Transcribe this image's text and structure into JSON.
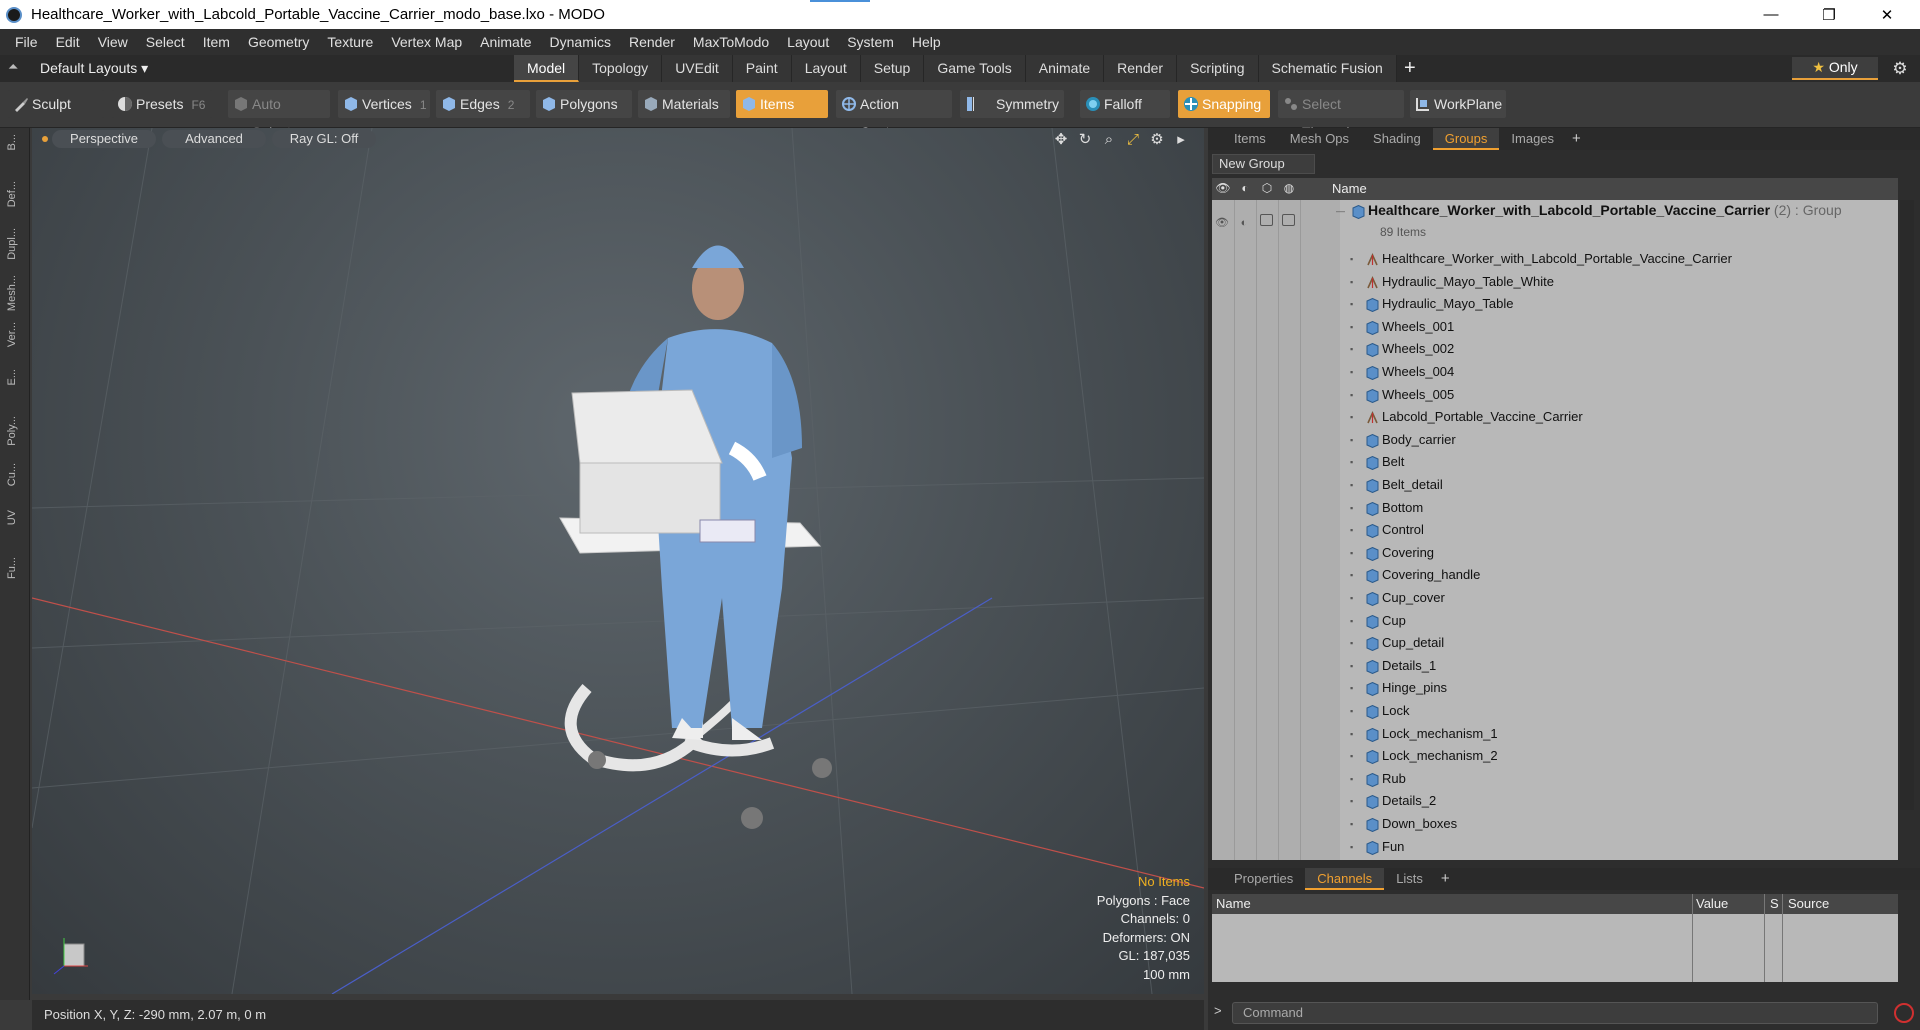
{
  "window": {
    "title": "Healthcare_Worker_with_Labcold_Portable_Vaccine_Carrier_modo_base.lxo - MODO",
    "minimize": "—",
    "maximize": "❐",
    "close": "✕"
  },
  "menu": [
    "File",
    "Edit",
    "View",
    "Select",
    "Item",
    "Geometry",
    "Texture",
    "Vertex Map",
    "Animate",
    "Dynamics",
    "Render",
    "MaxToModo",
    "Layout",
    "System",
    "Help"
  ],
  "layouts": {
    "label": "Default Layouts ▾"
  },
  "tabs": [
    "Model",
    "Topology",
    "UVEdit",
    "Paint",
    "Layout",
    "Setup",
    "Game Tools",
    "Animate",
    "Render",
    "Scripting",
    "Schematic Fusion"
  ],
  "tabs_active": "Model",
  "tab_add": "+",
  "only": {
    "star": "★",
    "label": "Only"
  },
  "toolbar": {
    "sculpt": "Sculpt",
    "presets": "Presets",
    "presets_key": "F6",
    "auto_select": "Auto Select",
    "vertices": "Vertices",
    "vertices_count": "1",
    "edges": "Edges",
    "edges_count": "2",
    "polygons": "Polygons",
    "materials": "Materials",
    "items": "Items",
    "action_center": "Action Center",
    "symmetry": "Symmetry",
    "falloff": "Falloff",
    "snapping": "Snapping",
    "select_through": "Select Through",
    "workplane": "WorkPlane"
  },
  "left_strip": [
    "B...",
    "Def...",
    "Dupl...",
    "Mesh...",
    "Ver...",
    "E...",
    "Poly...",
    "Cu...",
    "UV",
    "Fu..."
  ],
  "viewport": {
    "perspective": "Perspective",
    "advanced": "Advanced",
    "raygl": "Ray GL: Off",
    "stats": {
      "no_items": "No Items",
      "polygons": "Polygons : Face",
      "channels": "Channels: 0",
      "deformers": "Deformers: ON",
      "gl": "GL: 187,035",
      "scale": "100 mm"
    }
  },
  "status": {
    "position": "Position X, Y, Z:  -290 mm, 2.07 m, 0 m"
  },
  "right_tabs": [
    "Items",
    "Mesh Ops",
    "Shading",
    "Groups",
    "Images"
  ],
  "right_tabs_active": "Groups",
  "new_group": "New Group",
  "tree": {
    "name_header": "Name",
    "group": {
      "name": "Healthcare_Worker_with_Labcold_Portable_Vaccine_Carrier",
      "suffix": " (2) : Group",
      "count": "89 Items"
    },
    "items": [
      {
        "label": "Healthcare_Worker_with_Labcold_Portable_Vaccine_Carrier",
        "type": "locator"
      },
      {
        "label": "Hydraulic_Mayo_Table_White",
        "type": "locator"
      },
      {
        "label": "Hydraulic_Mayo_Table",
        "type": "mesh"
      },
      {
        "label": "Wheels_001",
        "type": "mesh"
      },
      {
        "label": "Wheels_002",
        "type": "mesh"
      },
      {
        "label": "Wheels_004",
        "type": "mesh"
      },
      {
        "label": "Wheels_005",
        "type": "mesh"
      },
      {
        "label": "Labcold_Portable_Vaccine_Carrier",
        "type": "locator"
      },
      {
        "label": "Body_carrier",
        "type": "mesh"
      },
      {
        "label": "Belt",
        "type": "mesh"
      },
      {
        "label": "Belt_detail",
        "type": "mesh"
      },
      {
        "label": "Bottom",
        "type": "mesh"
      },
      {
        "label": "Control",
        "type": "mesh"
      },
      {
        "label": "Covering",
        "type": "mesh"
      },
      {
        "label": "Covering_handle",
        "type": "mesh"
      },
      {
        "label": "Cup_cover",
        "type": "mesh"
      },
      {
        "label": "Cup",
        "type": "mesh"
      },
      {
        "label": "Cup_detail",
        "type": "mesh"
      },
      {
        "label": "Details_1",
        "type": "mesh"
      },
      {
        "label": "Hinge_pins",
        "type": "mesh"
      },
      {
        "label": "Lock",
        "type": "mesh"
      },
      {
        "label": "Lock_mechanism_1",
        "type": "mesh"
      },
      {
        "label": "Lock_mechanism_2",
        "type": "mesh"
      },
      {
        "label": "Rub",
        "type": "mesh"
      },
      {
        "label": "Details_2",
        "type": "mesh"
      },
      {
        "label": "Down_boxes",
        "type": "mesh"
      },
      {
        "label": "Fun",
        "type": "mesh"
      }
    ]
  },
  "bottom_tabs": [
    "Properties",
    "Channels",
    "Lists"
  ],
  "bottom_tabs_active": "Channels",
  "channels": {
    "name": "Name",
    "value": "Value",
    "s": "S",
    "source": "Source"
  },
  "command": {
    "prompt": ">",
    "placeholder": "Command"
  },
  "colors": {
    "accent": "#e8a03a",
    "tree_bg": "#b8b8b8",
    "panel_bg": "#2d2d2d"
  }
}
